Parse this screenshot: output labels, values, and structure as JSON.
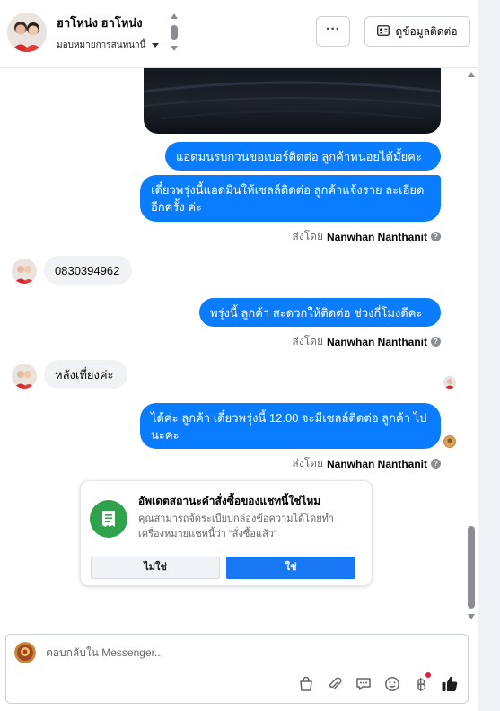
{
  "header": {
    "contact_name": "ฮาโหน่ง ฮาโหน่ง",
    "assign_label": "มอบหมายการสนทนานี้",
    "more_label": "···",
    "view_contact_label": "ดูข้อมูลติดต่อ"
  },
  "messages": {
    "out1": "แอดมนรบกวนขอเบอร์ติดต่อ ลูกค้าหน่อยได้มั้ยคะ",
    "out2": "เดี๋ยวพรุ่งนี้แอดมินให้เซลล์ติดต่อ ลูกค้าแจ้งราย ละเอียดอีกครั้ง ค่ะ",
    "in1": "0830394962",
    "out3": "พรุ่งนี้ ลูกค้า สะดวกให้ติดต่อ ช่วงกี่โมงดีคะ",
    "in2": "หลังเที่ยงค่ะ",
    "out4": "ได้ค่ะ  ลูกค้า เดี๋ยวพรุ่งนี้ 12.00 จะมีเซลล์ติดต่อ ลูกค้า ไปนะคะ",
    "sent_by_prefix": "ส่งโดย",
    "sent_by_name": "Nanwhan Nanthanit"
  },
  "card": {
    "title": "อัพเดตสถานะคำสั่งซื้อของแชทนี้ใช่ไหม",
    "body": "คุณสามารถจัดระเบียบกล่องข้อความได้โดยทำเครื่องหมายแชทนี้ว่า \"สั่งซื้อแล้ว\"",
    "no_label": "ไม่ใช่",
    "yes_label": "ใช่"
  },
  "composer": {
    "placeholder": "ตอบกลับใน Messenger..."
  },
  "colors": {
    "outgoing_bubble": "#0a7cff",
    "incoming_bubble": "#f0f2f5",
    "primary_button": "#1877f2",
    "order_icon_bg": "#31a24c"
  },
  "icons": {
    "toolbar": [
      "shopping-bag-icon",
      "paperclip-icon",
      "saved-replies-icon",
      "emoji-icon",
      "baht-payment-icon",
      "thumbs-up-icon"
    ]
  }
}
